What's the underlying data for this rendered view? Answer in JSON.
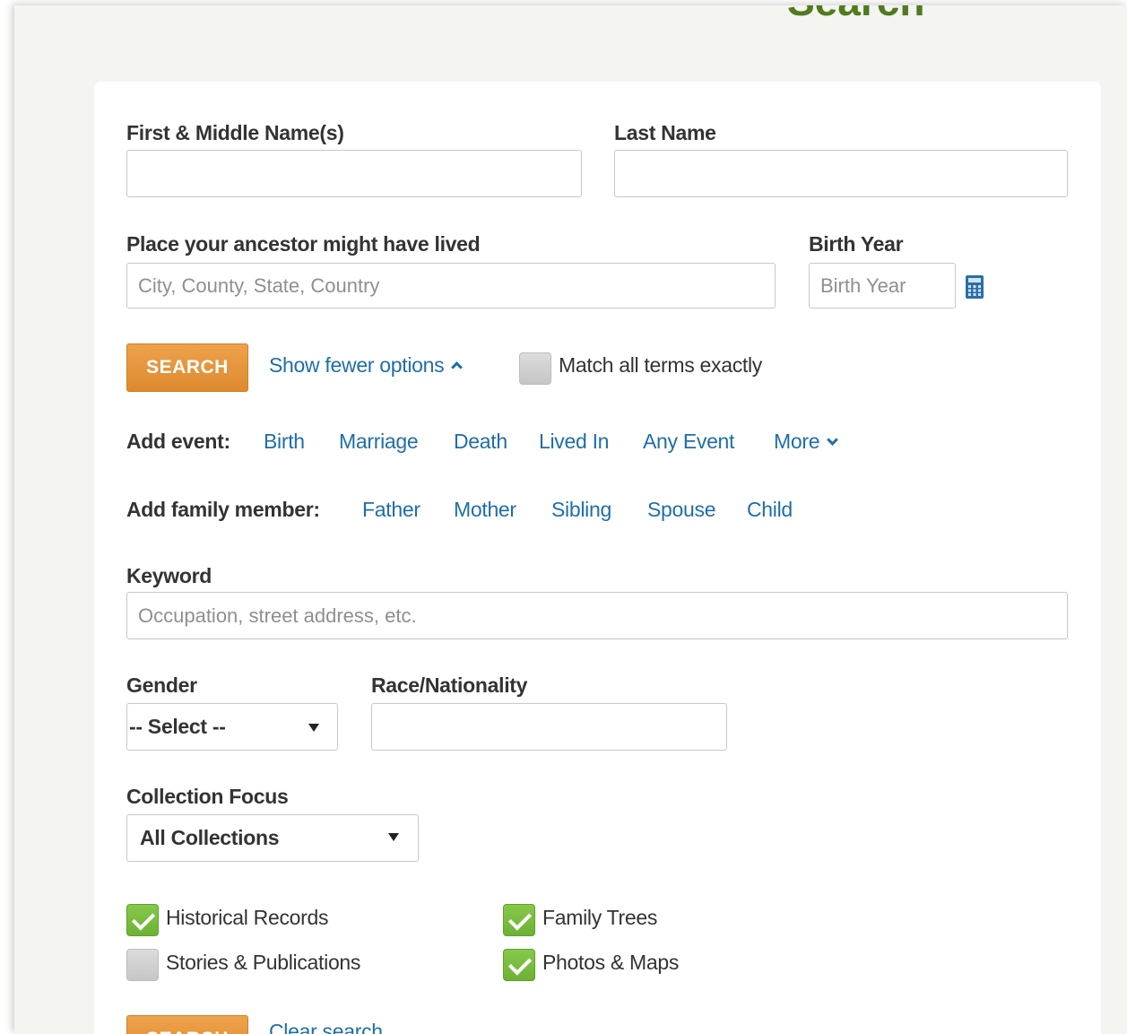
{
  "page": {
    "title": "Search"
  },
  "form": {
    "first_name": {
      "label": "First & Middle Name(s)",
      "value": "",
      "placeholder": ""
    },
    "last_name": {
      "label": "Last Name",
      "value": "",
      "placeholder": ""
    },
    "place": {
      "label": "Place your ancestor might have lived",
      "value": "",
      "placeholder": "City, County, State, Country"
    },
    "birth_year": {
      "label": "Birth Year",
      "value": "",
      "placeholder": "Birth Year",
      "icon": "calculator-icon"
    },
    "search_button": "SEARCH",
    "show_fewer_options": "Show fewer options",
    "match_exact": {
      "label": "Match all terms exactly",
      "checked": false
    },
    "add_event": {
      "label": "Add event:",
      "items": [
        "Birth",
        "Marriage",
        "Death",
        "Lived In",
        "Any Event"
      ],
      "more": "More"
    },
    "add_family": {
      "label": "Add family member:",
      "items": [
        "Father",
        "Mother",
        "Sibling",
        "Spouse",
        "Child"
      ]
    },
    "keyword": {
      "label": "Keyword",
      "value": "",
      "placeholder": "Occupation, street address, etc."
    },
    "gender": {
      "label": "Gender",
      "selected": "-- Select --"
    },
    "race": {
      "label": "Race/Nationality",
      "value": ""
    },
    "collection_focus": {
      "label": "Collection Focus",
      "selected": "All Collections"
    },
    "record_types": [
      {
        "label": "Historical Records",
        "checked": true
      },
      {
        "label": "Family Trees",
        "checked": true
      },
      {
        "label": "Stories & Publications",
        "checked": false
      },
      {
        "label": "Photos & Maps",
        "checked": true
      }
    ],
    "bottom_search_button": "SEARCH",
    "clear_search": "Clear search"
  },
  "colors": {
    "title_green": "#4f7a1e",
    "link_blue": "#1f6ea8",
    "button_orange": "#e4933a",
    "check_green": "#7bbf3f"
  }
}
